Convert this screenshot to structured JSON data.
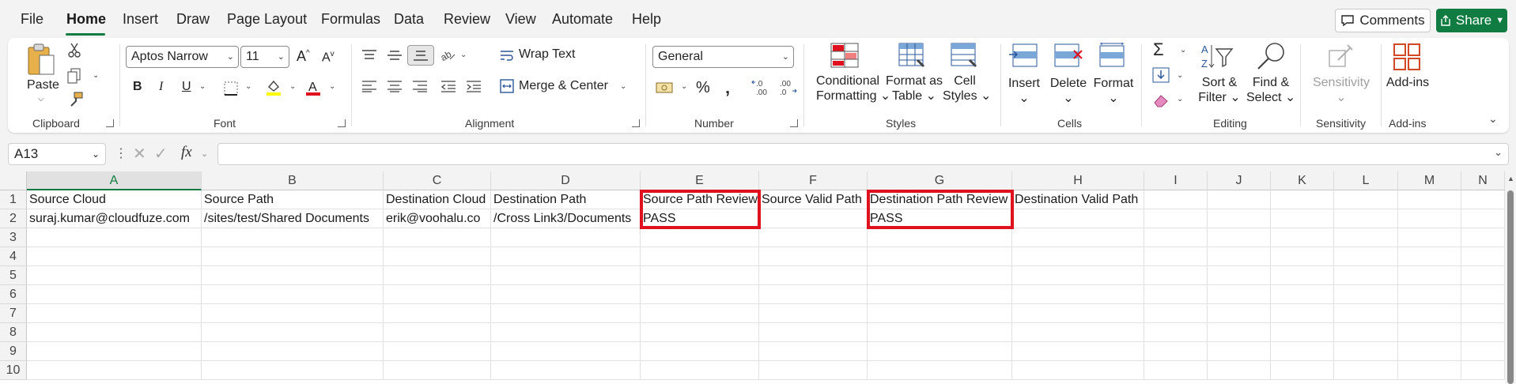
{
  "menu": {
    "tabs": [
      "File",
      "Home",
      "Insert",
      "Draw",
      "Page Layout",
      "Formulas",
      "Data",
      "Review",
      "View",
      "Automate",
      "Help"
    ],
    "active_tab": "Home",
    "comments_label": "Comments",
    "share_label": "Share"
  },
  "ribbon": {
    "clipboard": {
      "paste_label": "Paste",
      "group_label": "Clipboard"
    },
    "font": {
      "font_name": "Aptos Narrow",
      "font_size": "11",
      "group_label": "Font",
      "highlight_color": "#ffff00",
      "font_color": "#e0111e"
    },
    "alignment": {
      "wrap_text": "Wrap Text",
      "merge_center": "Merge & Center",
      "group_label": "Alignment"
    },
    "number": {
      "format": "General",
      "group_label": "Number"
    },
    "styles": {
      "conditional_formatting": [
        "Conditional",
        "Formatting"
      ],
      "format_as_table": [
        "Format as",
        "Table"
      ],
      "cell_styles": [
        "Cell",
        "Styles"
      ],
      "group_label": "Styles"
    },
    "cells": {
      "insert": "Insert",
      "delete": "Delete",
      "format": "Format",
      "group_label": "Cells"
    },
    "editing": {
      "sort_filter": [
        "Sort &",
        "Filter"
      ],
      "find_select": [
        "Find &",
        "Select"
      ],
      "group_label": "Editing"
    },
    "sensitivity": {
      "label": "Sensitivity",
      "group_label": "Sensitivity"
    },
    "addins": {
      "label": "Add-ins",
      "group_label": "Add-ins"
    }
  },
  "formula_bar": {
    "name_box": "A13",
    "fx": "fx",
    "formula": ""
  },
  "sheet": {
    "columns": [
      "A",
      "B",
      "C",
      "D",
      "E",
      "F",
      "G",
      "H",
      "I",
      "J",
      "K",
      "L",
      "M",
      "N"
    ],
    "selected_column": "A",
    "row_numbers": [
      "1",
      "2",
      "3",
      "4",
      "5",
      "6",
      "7",
      "8",
      "9",
      "10"
    ],
    "rows": [
      [
        "Source Cloud",
        "Source Path",
        "Destination Cloud",
        "Destination Path",
        "Source Path Review",
        "Source Valid Path",
        "Destination Path Review",
        "Destination Valid Path"
      ],
      [
        "suraj.kumar@cloudfuze.com",
        "/sites/test/Shared Documents",
        "erik@voohalu.co",
        "/Cross Link3/Documents",
        "PASS",
        "",
        "PASS",
        ""
      ]
    ],
    "highlight_color": "#e0111e"
  }
}
